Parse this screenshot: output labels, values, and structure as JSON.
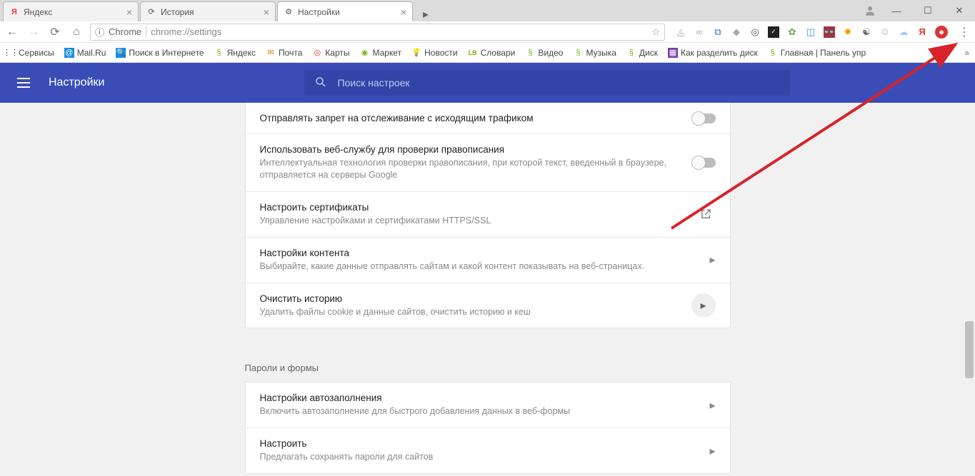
{
  "window": {
    "tabs": [
      {
        "title": "Яндекс",
        "icon": "Я"
      },
      {
        "title": "История",
        "icon": "⟳"
      },
      {
        "title": "Настройки",
        "icon": "⚙"
      }
    ],
    "omnibox_label": "Chrome",
    "url": "chrome://settings",
    "extensions_red_letter": "Я"
  },
  "bookmarks": [
    {
      "label": "Сервисы",
      "icon": "⋮⋮"
    },
    {
      "label": "Mail.Ru",
      "icon": "@"
    },
    {
      "label": "Поиск в Интернете",
      "icon": "🔍"
    },
    {
      "label": "Яндекс",
      "icon": "§"
    },
    {
      "label": "Почта",
      "icon": "✉"
    },
    {
      "label": "Карты",
      "icon": "◎"
    },
    {
      "label": "Маркет",
      "icon": "◉"
    },
    {
      "label": "Новости",
      "icon": "💡"
    },
    {
      "label": "Словари",
      "icon": "LB"
    },
    {
      "label": "Видео",
      "icon": "§"
    },
    {
      "label": "Музыка",
      "icon": "§"
    },
    {
      "label": "Диск",
      "icon": "§"
    },
    {
      "label": "Как разделить диск",
      "icon": "▦"
    },
    {
      "label": "Главная | Панель упр",
      "icon": "§"
    }
  ],
  "header": {
    "title": "Настройки",
    "search_placeholder": "Поиск настроек"
  },
  "settings": {
    "rows": [
      {
        "title": "Отправлять запрет на отслеживание с исходящим трафиком",
        "sub": "",
        "right": "toggle"
      },
      {
        "title": "Использовать веб-службу для проверки правописания",
        "sub": "Интеллектуальная технология проверки правописания, при которой текст, введенный в браузере, отправляется на серверы Google",
        "right": "toggle"
      },
      {
        "title": "Настроить сертификаты",
        "sub": "Управление настройками и сертификатами HTTPS/SSL",
        "right": "open"
      },
      {
        "title": "Настройки контента",
        "sub": "Выбирайте, какие данные отправлять сайтам и какой контент показывать на веб-страницах.",
        "right": "chev"
      },
      {
        "title": "Очистить историю",
        "sub": "Удалить файлы cookie и данные сайтов, очистить историю и кеш",
        "right": "circle"
      }
    ],
    "section2_label": "Пароли и формы",
    "rows2": [
      {
        "title": "Настройки автозаполнения",
        "sub": "Включить автозаполнение для быстрого добавления данных в веб-формы",
        "right": "chev"
      },
      {
        "title": "Настроить",
        "sub": "Предлагать сохранять пароли для сайтов",
        "right": "chev"
      }
    ]
  }
}
